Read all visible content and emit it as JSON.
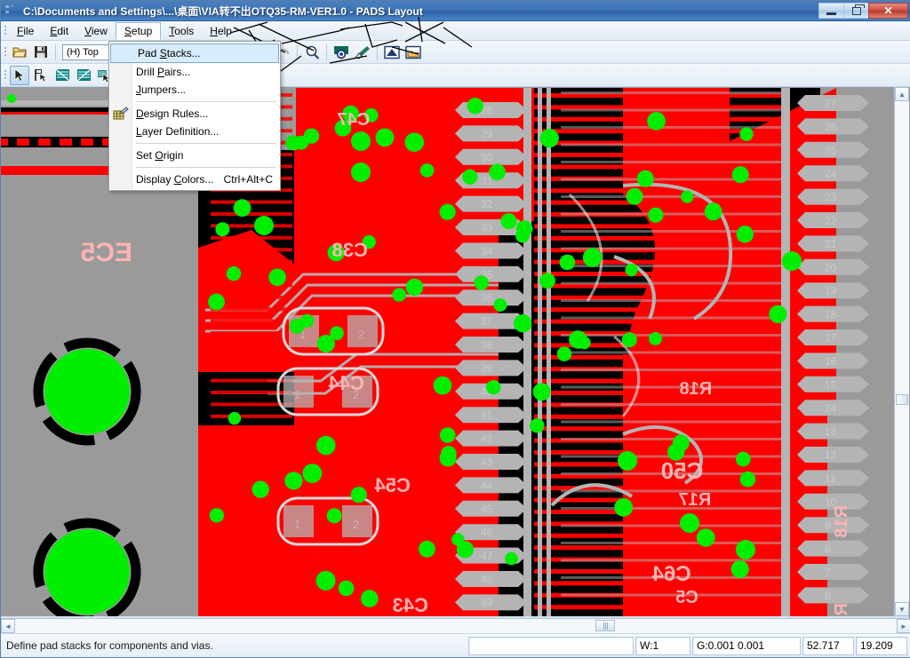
{
  "window": {
    "title": "C:\\Documents and Settings\\...\\桌面\\VIA转不出OTQ35-RM-VER1.0 - PADS Layout",
    "icon": "pads-app-icon",
    "buttons": {
      "minimize": "minimize-button",
      "maximize": "restore-button",
      "close": "✕"
    }
  },
  "menubar": {
    "items": [
      {
        "label": "File",
        "mnemonic": "F",
        "active": false
      },
      {
        "label": "Edit",
        "mnemonic": "E",
        "active": false
      },
      {
        "label": "View",
        "mnemonic": "V",
        "active": false
      },
      {
        "label": "Setup",
        "mnemonic": "S",
        "active": true
      },
      {
        "label": "Tools",
        "mnemonic": "T",
        "active": false
      },
      {
        "label": "Help",
        "mnemonic": "H",
        "active": false
      }
    ]
  },
  "dropdown": {
    "owner": "Setup",
    "items": [
      {
        "label": "Pad Stacks...",
        "mnemonic": "S",
        "accel": "",
        "highlighted": true,
        "icon": "",
        "separator_after": false
      },
      {
        "label": "Drill Pairs...",
        "mnemonic": "P",
        "accel": "",
        "highlighted": false,
        "icon": "",
        "separator_after": false
      },
      {
        "label": "Jumpers...",
        "mnemonic": "J",
        "accel": "",
        "highlighted": false,
        "icon": "",
        "separator_after": true
      },
      {
        "label": "Design Rules...",
        "mnemonic": "D",
        "accel": "",
        "highlighted": false,
        "icon": "design-rules-icon",
        "separator_after": false
      },
      {
        "label": "Layer Definition...",
        "mnemonic": "L",
        "accel": "",
        "highlighted": false,
        "icon": "",
        "separator_after": true
      },
      {
        "label": "Set Origin",
        "mnemonic": "O",
        "accel": "",
        "highlighted": false,
        "icon": "",
        "separator_after": true
      },
      {
        "label": "Display Colors...",
        "mnemonic": "C",
        "accel": "Ctrl+Alt+C",
        "highlighted": false,
        "icon": "",
        "separator_after": false
      }
    ]
  },
  "toolbar_row1": {
    "layer_value": "(H) Top",
    "buttons": [
      {
        "name": "open-file-icon"
      },
      {
        "name": "save-file-icon"
      },
      {
        "name": "layer-select-combo"
      },
      {
        "name": "board-outline-icon"
      },
      {
        "name": "draw-trace-icon"
      },
      {
        "name": "fanout-icon"
      },
      {
        "name": "undo-icon"
      },
      {
        "name": "redo-icon"
      },
      {
        "name": "zoom-icon"
      },
      {
        "name": "zoom-area-icon"
      },
      {
        "name": "paintbrush-icon"
      },
      {
        "name": "flip-board-icon"
      },
      {
        "name": "open-library-icon"
      }
    ]
  },
  "toolbar_row2": {
    "buttons": [
      {
        "name": "select-arrow-icon",
        "selected": true
      },
      {
        "name": "select-flag-icon",
        "selected": false
      },
      {
        "name": "layer-stack-icon-1",
        "selected": false
      },
      {
        "name": "layer-stack-icon-2",
        "selected": false
      },
      {
        "name": "pour-manager-icon",
        "selected": false
      }
    ]
  },
  "statusbar": {
    "message": "Define pad stacks for components and vias.",
    "cells": [
      {
        "name": "status-prompt-field",
        "value": ""
      },
      {
        "name": "status-width-field",
        "value": "W:1"
      },
      {
        "name": "status-grid-field",
        "value": "G:0.001 0.001"
      },
      {
        "name": "status-x-coordinate",
        "value": "52.717"
      },
      {
        "name": "status-y-coordinate",
        "value": "19.209"
      }
    ]
  },
  "canvas": {
    "background": "#9a9a9a",
    "colors": {
      "copper_red": "#ff0000",
      "copper_gray": "#b4b4b4",
      "plane_black": "#000000",
      "via_green": "#00ee00",
      "silk_pink": "#ffb3b3",
      "pad_label": "#cfcfcf"
    },
    "silkscreen_refs": [
      "EC5",
      "C47",
      "C38",
      "C44",
      "C43",
      "C50",
      "C54",
      "R18",
      "R17",
      "C64",
      "C5"
    ],
    "pad_numbers_center": [
      28,
      29,
      30,
      31,
      32,
      33,
      34,
      35,
      36,
      37,
      38,
      39,
      40,
      41,
      42,
      43,
      44,
      45,
      46,
      47,
      48,
      49
    ],
    "pad_numbers_right": [
      27,
      26,
      25,
      24,
      23,
      22,
      21,
      20,
      19,
      18,
      17,
      16,
      15,
      14,
      13,
      12,
      11,
      10,
      9,
      8,
      7,
      6
    ],
    "connector_holes": 2
  },
  "scrollbars": {
    "vertical": {
      "name": "vertical-scrollbar",
      "up": "▲",
      "down": "▼"
    },
    "horizontal": {
      "name": "horizontal-scrollbar",
      "left": "◄",
      "right": "►"
    }
  }
}
